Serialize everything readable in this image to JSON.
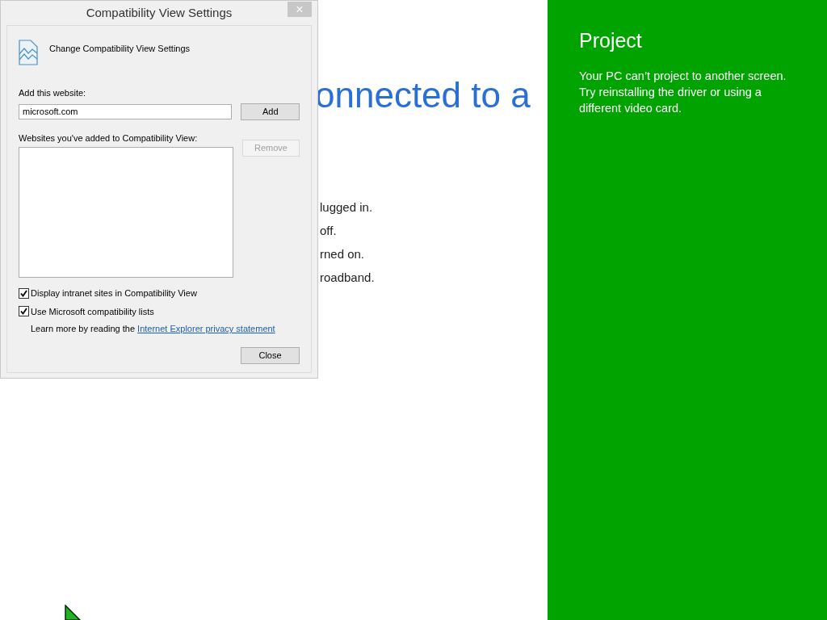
{
  "background_page": {
    "heading": "onnected to a",
    "lines": [
      "lugged in.",
      "off.",
      "rned on.",
      "roadband."
    ]
  },
  "charm_pane": {
    "title": "Project",
    "message": "Your PC can’t project to another screen. Try reinstalling the driver or using a different video card."
  },
  "dialog": {
    "title": "Compatibility View Settings",
    "close_glyph": "×",
    "header": "Change Compatibility View Settings",
    "add_label": "Add this website:",
    "add_value": "microsoft.com",
    "add_button": {
      "label": "Add",
      "disabled": false
    },
    "list_label": "Websites you've added to Compatibility View:",
    "remove_button": {
      "label": "Remove",
      "disabled": true
    },
    "options": [
      {
        "label": "Display intranet sites in Compatibility View",
        "checked": true
      },
      {
        "label": "Use Microsoft compatibility lists",
        "checked": true
      }
    ],
    "learn_more": "Learn more by reading the",
    "privacy_link": "Internet Explorer privacy statement",
    "close_button": {
      "label": "Close",
      "disabled": false
    }
  }
}
